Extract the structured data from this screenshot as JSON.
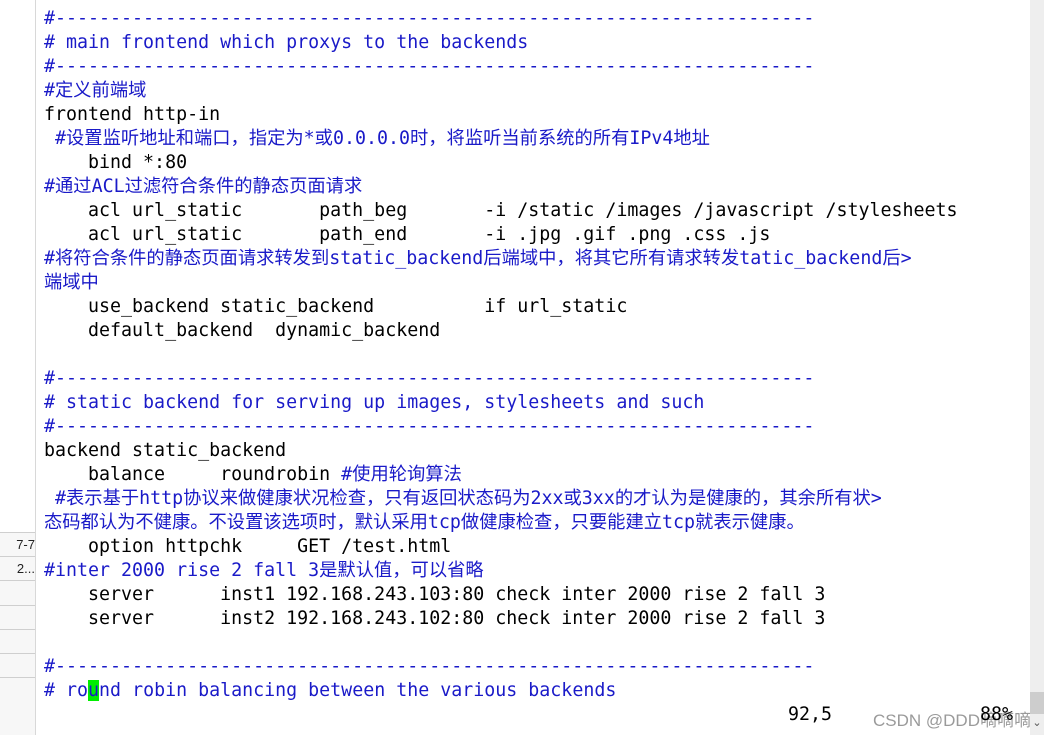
{
  "sidebar": {
    "rows": [
      "7-7",
      "2...",
      "",
      "",
      "",
      "",
      ""
    ]
  },
  "colors": {
    "comment": "#1a1ac8",
    "text": "#000000",
    "cursor": "#00ee00"
  },
  "editor": {
    "lines": [
      [
        {
          "t": "#---------------------------------------------------------------------",
          "c": 1
        }
      ],
      [
        {
          "t": "# main frontend which proxys to the backends",
          "c": 1
        }
      ],
      [
        {
          "t": "#---------------------------------------------------------------------",
          "c": 1
        }
      ],
      [
        {
          "t": "#定义前端域",
          "c": 1
        }
      ],
      [
        {
          "t": "frontend http-in",
          "c": 0
        }
      ],
      [
        {
          "t": " #设置监听地址和端口，指定为*或0.0.0.0时，将监听当前系统的所有IPv4地址",
          "c": 1
        }
      ],
      [
        {
          "t": "    bind *:80",
          "c": 0
        }
      ],
      [
        {
          "t": "#通过ACL过滤符合条件的静态页面请求",
          "c": 1
        }
      ],
      [
        {
          "t": "    acl url_static       path_beg       -i /static /images /javascript /stylesheets",
          "c": 0
        }
      ],
      [
        {
          "t": "    acl url_static       path_end       -i .jpg .gif .png .css .js",
          "c": 0
        }
      ],
      [
        {
          "t": "#将符合条件的静态页面请求转发到static_backend后端域中，将其它所有请求转发tatic_backend后>",
          "c": 1
        }
      ],
      [
        {
          "t": "端域中",
          "c": 1
        }
      ],
      [
        {
          "t": "    use_backend static_backend          if url_static",
          "c": 0
        }
      ],
      [
        {
          "t": "    default_backend  dynamic_backend",
          "c": 0
        }
      ],
      [],
      [
        {
          "t": "#---------------------------------------------------------------------",
          "c": 1
        }
      ],
      [
        {
          "t": "# static backend for serving up images, stylesheets and such",
          "c": 1
        }
      ],
      [
        {
          "t": "#---------------------------------------------------------------------",
          "c": 1
        }
      ],
      [
        {
          "t": "backend static_backend",
          "c": 0
        }
      ],
      [
        {
          "t": "    balance     roundrobin ",
          "c": 0
        },
        {
          "t": "#使用轮询算法",
          "c": 1
        }
      ],
      [
        {
          "t": " #表示基于http协议来做健康状况检查，只有返回状态码为2xx或3xx的才认为是健康的，其余所有状>",
          "c": 1
        }
      ],
      [
        {
          "t": "态码都认为不健康。不设置该选项时，默认采用tcp做健康检查，只要能建立tcp就表示健康。",
          "c": 1
        }
      ],
      [
        {
          "t": "    option httpchk     GET /test.html",
          "c": 0
        }
      ],
      [
        {
          "t": "#inter 2000 rise 2 fall 3是默认值，可以省略",
          "c": 1
        }
      ],
      [
        {
          "t": "    server      inst1 192.168.243.103:80 check inter 2000 rise 2 fall 3",
          "c": 0
        }
      ],
      [
        {
          "t": "    server      inst2 192.168.243.102:80 check inter 2000 rise 2 fall 3",
          "c": 0
        }
      ],
      [],
      [
        {
          "t": "#---------------------------------------------------------------------",
          "c": 1
        }
      ],
      [
        {
          "t": "# ro",
          "c": 1
        },
        {
          "t": "u",
          "c": 1,
          "cur": 1
        },
        {
          "t": "nd robin balancing between the various backends",
          "c": 1
        }
      ]
    ]
  },
  "status": {
    "position": "92,5",
    "percent": "88%"
  },
  "watermark": "CSDN @DDD嘀嘀嘀"
}
